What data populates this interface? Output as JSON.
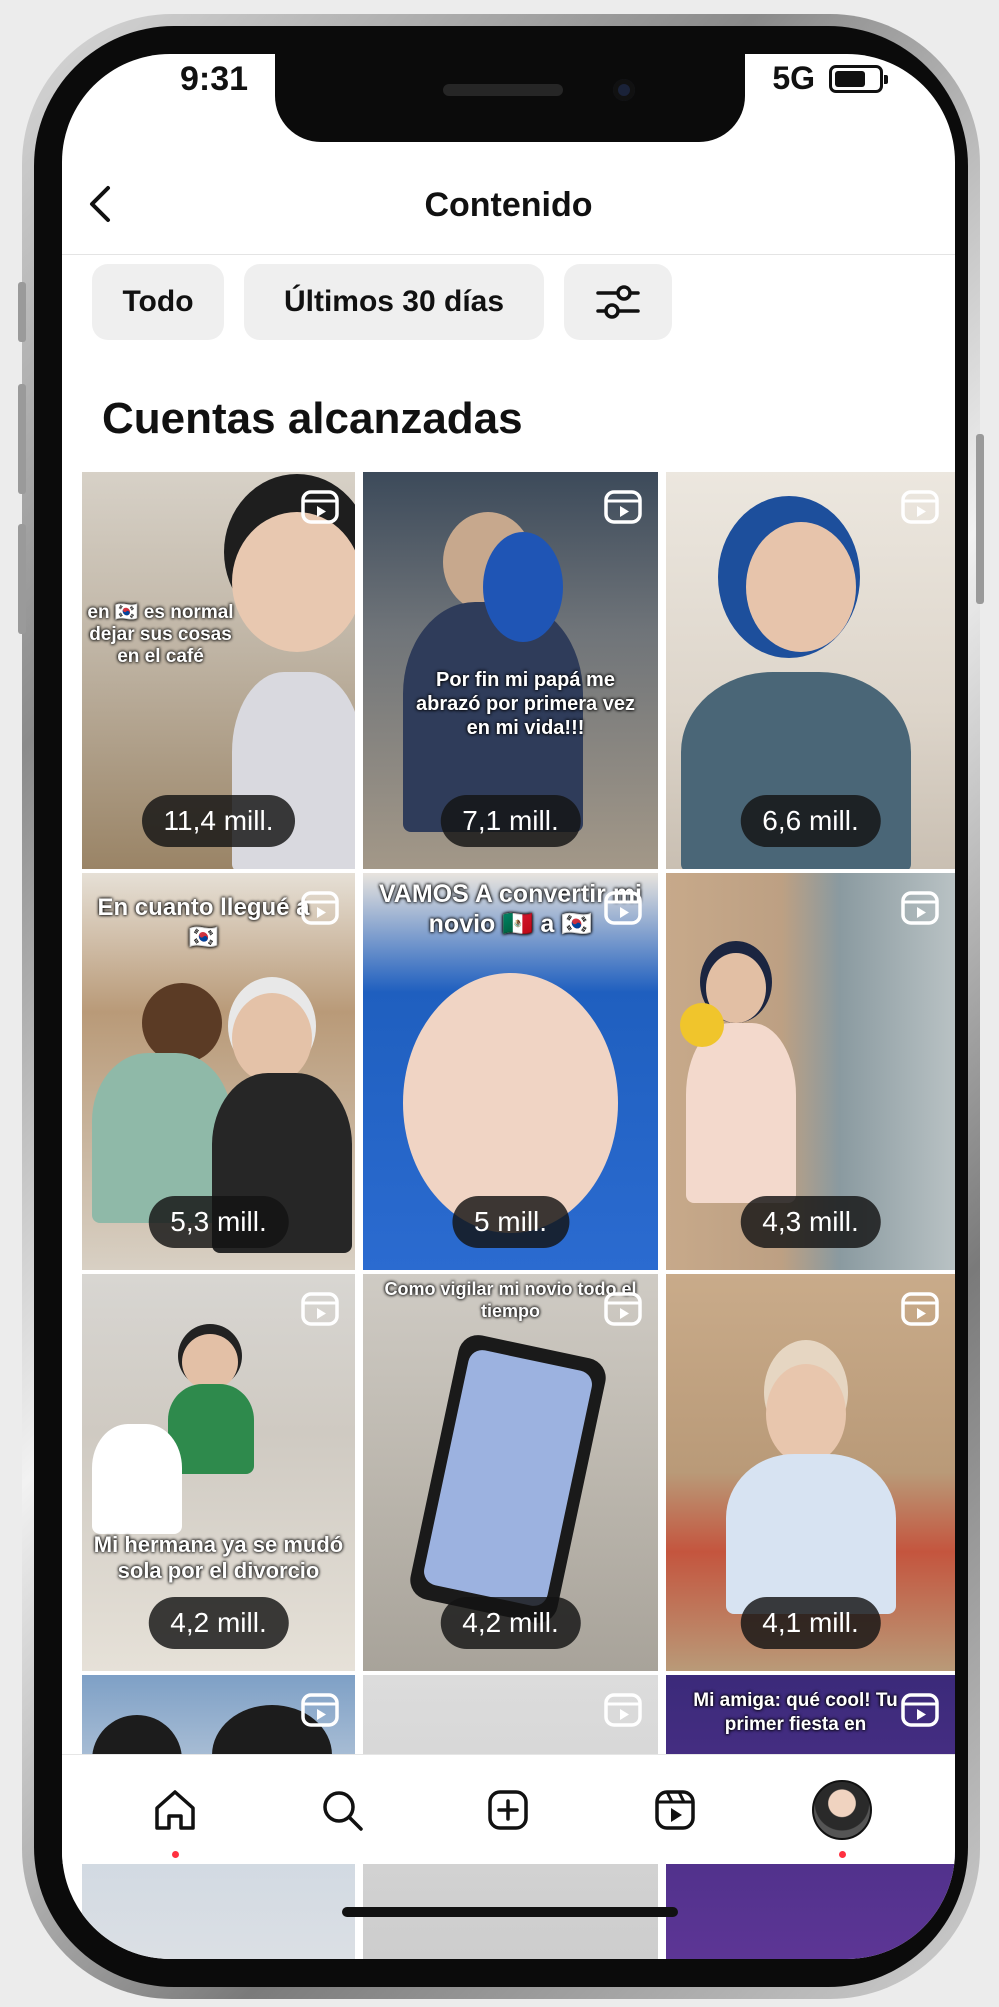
{
  "status_bar": {
    "time": "9:31",
    "network": "5G"
  },
  "header": {
    "title": "Contenido"
  },
  "filters": {
    "all": "Todo",
    "period": "Últimos 30 días"
  },
  "section": {
    "title": "Cuentas alcanzadas"
  },
  "tiles": [
    {
      "count": "11,4 mill.",
      "caption": "en 🇰🇷 es normal dejar sus cosas en el café"
    },
    {
      "count": "7,1 mill.",
      "caption": "Por fin mi papá me abrazó por primera vez en mi vida!!!"
    },
    {
      "count": "6,6 mill.",
      "caption": ""
    },
    {
      "count": "5,3 mill.",
      "caption": "En cuanto llegué a 🇰🇷"
    },
    {
      "count": "5 mill.",
      "caption": "VAMOS A convertir mi novio 🇲🇽 a 🇰🇷"
    },
    {
      "count": "4,3 mill.",
      "caption": ""
    },
    {
      "count": "4,2 mill.",
      "caption": "Mi hermana ya se mudó sola por el divorcio"
    },
    {
      "count": "4,2 mill.",
      "caption": "Como vigilar mi novio todo el tiempo"
    },
    {
      "count": "4,1 mill.",
      "caption": ""
    },
    {
      "count": "",
      "caption": ""
    },
    {
      "count": "",
      "caption": ""
    },
    {
      "count": "",
      "caption": "Mi amiga: qué cool! Tu primer fiesta en"
    }
  ],
  "tab_bar": [
    "home-icon",
    "search-icon",
    "create-icon",
    "reels-icon",
    "profile-avatar"
  ]
}
